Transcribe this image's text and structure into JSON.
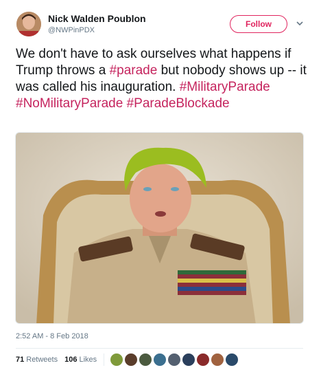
{
  "user": {
    "name": "Nick Walden Poublon",
    "handle": "@NWPinPDX",
    "follow_label": "Follow"
  },
  "tweet": {
    "text_parts": [
      {
        "text": "We don't have to ask ourselves what happens if Trump throws a ",
        "tag": false
      },
      {
        "text": "#parade",
        "tag": true
      },
      {
        "text": " but nobody shows up -- it was called his inauguration. ",
        "tag": false
      },
      {
        "text": "#MilitaryParade",
        "tag": true
      },
      {
        "text": " ",
        "tag": false
      },
      {
        "text": "#NoMilitaryParade",
        "tag": true
      },
      {
        "text": " ",
        "tag": false
      },
      {
        "text": "#ParadeBlockade",
        "tag": true
      }
    ],
    "timestamp": "2:52 AM - 8 Feb 2018"
  },
  "stats": {
    "retweets_count": "71",
    "retweets_label": "Retweets",
    "likes_count": "106",
    "likes_label": "Likes"
  },
  "likers": [
    {
      "color": "#7f9a3a"
    },
    {
      "color": "#5a3d2b"
    },
    {
      "color": "#4b5a3f"
    },
    {
      "color": "#3b6f8f"
    },
    {
      "color": "#546070"
    },
    {
      "color": "#2b3f5c"
    },
    {
      "color": "#8a2a2a"
    },
    {
      "color": "#a0623f"
    },
    {
      "color": "#2a4a6a"
    }
  ],
  "colors": {
    "accent": "#e0245e",
    "hashtag": "#c5245e",
    "secondary_text": "#657786"
  }
}
